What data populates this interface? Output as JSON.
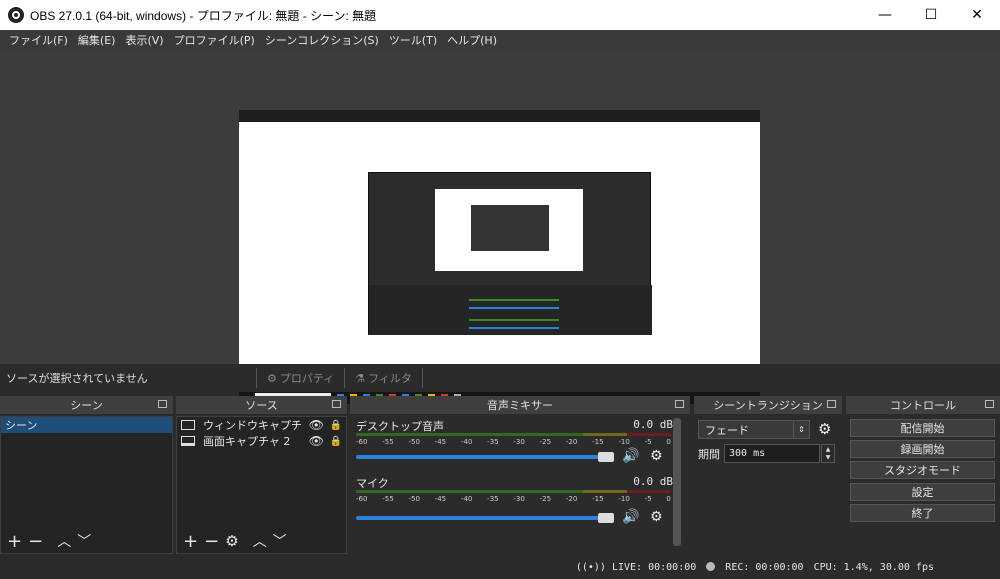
{
  "window": {
    "title": "OBS 27.0.1 (64-bit, windows) - プロファイル: 無題 - シーン: 無題",
    "minimize": "—",
    "maximize": "☐",
    "close": "✕"
  },
  "menu": [
    "ファイル(F)",
    "編集(E)",
    "表示(V)",
    "プロファイル(P)",
    "シーンコレクション(S)",
    "ツール(T)",
    "ヘルプ(H)"
  ],
  "source_toolbar": {
    "no_source": "ソースが選択されていません",
    "properties": "プロパティ",
    "filters": "フィルタ"
  },
  "scenes": {
    "header": "シーン",
    "items": [
      "シーン"
    ]
  },
  "sources": {
    "header": "ソース",
    "items": [
      "ウィンドウキャプチ",
      "画面キャプチャ 2"
    ]
  },
  "mixer": {
    "header": "音声ミキサー",
    "channels": [
      {
        "name": "デスクトップ音声",
        "db": "0.0 dB"
      },
      {
        "name": "マイク",
        "db": "0.0 dB"
      }
    ],
    "scale": [
      "-60",
      "-55",
      "-50",
      "-45",
      "-40",
      "-35",
      "-30",
      "-25",
      "-20",
      "-15",
      "-10",
      "-5",
      "0"
    ]
  },
  "transitions": {
    "header": "シーントランジション",
    "selected": "フェード",
    "duration_label": "期間",
    "duration": "300 ms"
  },
  "controls": {
    "header": "コントロール",
    "buttons": [
      "配信開始",
      "録画開始",
      "スタジオモード",
      "設定",
      "終了"
    ]
  },
  "statusbar": {
    "live": "LIVE: 00:00:00",
    "rec": "REC: 00:00:00",
    "cpu": "CPU: 1.4%, 30.00 fps"
  },
  "colors": {
    "background": "#2b2b2b",
    "dock_header": "#3f3f3f",
    "selection": "#1f4d7a",
    "volume": "#2a82da"
  }
}
